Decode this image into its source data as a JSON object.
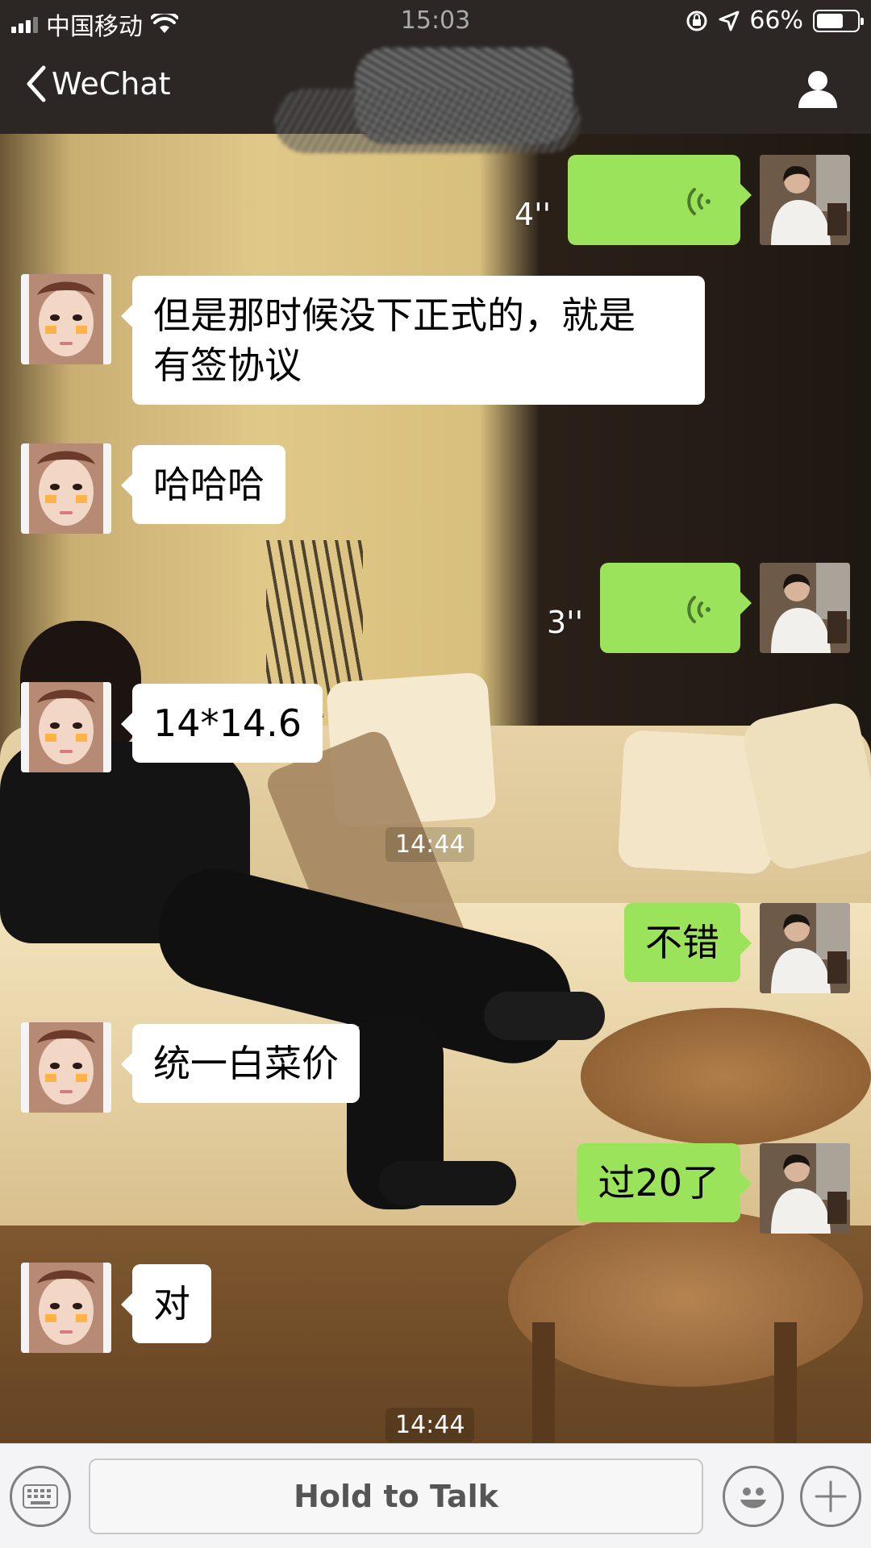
{
  "status_bar": {
    "carrier": "中国移动",
    "time": "15:03",
    "battery": "66%",
    "battery_level": 0.66
  },
  "nav": {
    "back_label": "WeChat"
  },
  "messages": {
    "m1": {
      "duration": "4''"
    },
    "m2": {
      "text_line1": "但是那时候没下正式的，就是",
      "text_line2": "有签协议"
    },
    "m3": {
      "text": "哈哈哈"
    },
    "m4": {
      "duration": "3''"
    },
    "m5": {
      "text": "14*14.6"
    },
    "ts1": "14:44",
    "m6": {
      "text": "不错"
    },
    "m7": {
      "text": "统一白菜价"
    },
    "m8": {
      "text": "过20了"
    },
    "m9": {
      "text": "对"
    },
    "ts2": "14:44"
  },
  "input_bar": {
    "hold_to_talk": "Hold to Talk"
  },
  "colors": {
    "bar_bg": "#2c2724",
    "green_bubble": "#9be35a",
    "white_bubble": "#ffffff"
  }
}
